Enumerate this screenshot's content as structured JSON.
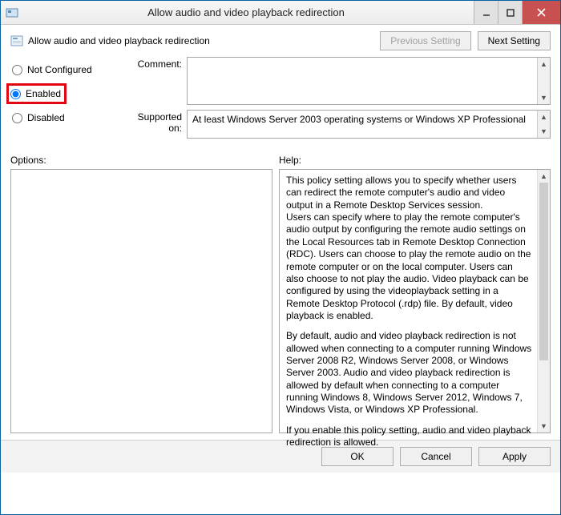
{
  "window": {
    "title": "Allow audio and video playback redirection"
  },
  "header": {
    "policy_name": "Allow audio and video playback redirection",
    "prev_btn": "Previous Setting",
    "next_btn": "Next Setting"
  },
  "radios": {
    "not_configured": "Not Configured",
    "enabled": "Enabled",
    "disabled": "Disabled",
    "selected": "enabled"
  },
  "labels": {
    "comment": "Comment:",
    "supported": "Supported on:",
    "options": "Options:",
    "help": "Help:"
  },
  "supported_text": "At least Windows Server 2003 operating systems or Windows XP Professional",
  "comment_value": "",
  "help_paragraphs": {
    "p1": "This policy setting allows you to specify whether users can redirect the remote computer's audio and video output in a Remote Desktop Services session.",
    "p2": "Users can specify where to play the remote computer's audio output by configuring the remote audio settings on the Local Resources tab in Remote Desktop Connection (RDC). Users can choose to play the remote audio on the remote computer or on the local computer. Users can also choose to not play the audio. Video playback can be configured by using the videoplayback setting in a Remote Desktop Protocol (.rdp) file. By default, video playback is enabled.",
    "p3": "By default, audio and video playback redirection is not allowed when connecting to a computer running Windows Server 2008 R2, Windows Server 2008, or Windows Server 2003. Audio and video playback redirection is allowed by default when connecting to a computer running Windows 8, Windows Server 2012, Windows 7, Windows Vista, or Windows XP Professional.",
    "p4": "If you enable this policy setting, audio and video playback redirection is allowed."
  },
  "footer": {
    "ok": "OK",
    "cancel": "Cancel",
    "apply": "Apply"
  }
}
